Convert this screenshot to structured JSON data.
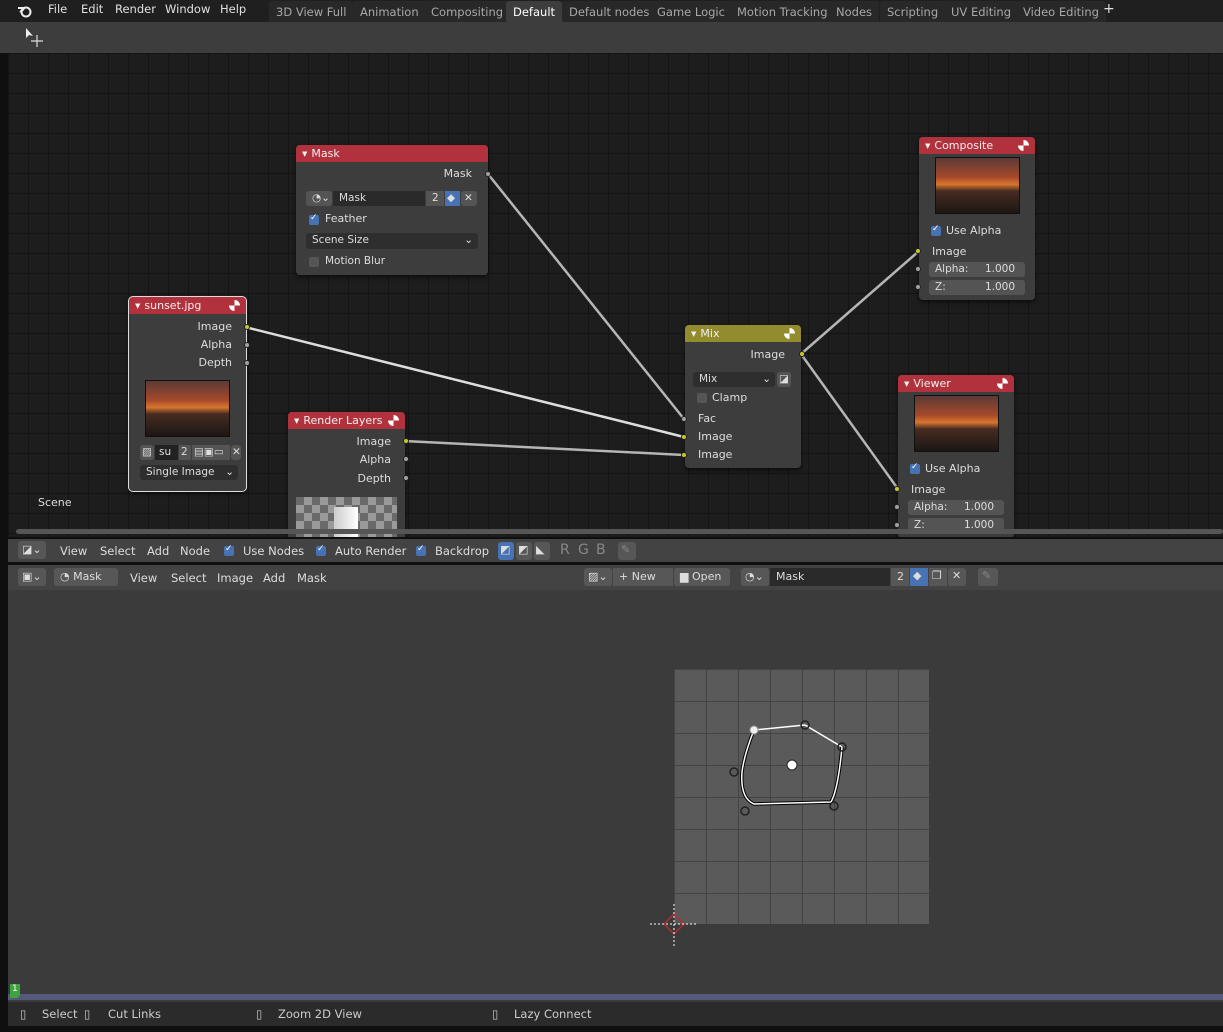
{
  "app": {
    "logo": "blender-logo-icon"
  },
  "menu": [
    "File",
    "Edit",
    "Render",
    "Window",
    "Help"
  ],
  "workspaces": [
    "3D View Full",
    "Animation",
    "Compositing",
    "Default",
    "Default nodes",
    "Game Logic",
    "Motion Tracking",
    "Nodes",
    "Scripting",
    "UV Editing",
    "Video Editing"
  ],
  "active_workspace": "Default",
  "add_workspace": "+",
  "node_editor": {
    "scene_label": "Scene",
    "nodes": {
      "mask": {
        "title": "Mask",
        "output": "Mask",
        "datablock": "Mask",
        "users": "2",
        "feather": "Feather",
        "feather_on": true,
        "size": "Scene Size",
        "motion_blur": "Motion Blur",
        "motion_blur_on": false
      },
      "sunset": {
        "title": "sunset.jpg",
        "outputs": [
          "Image",
          "Alpha",
          "Depth"
        ],
        "image_name": "su",
        "users": "2",
        "source": "Single Image"
      },
      "render_layers": {
        "title": "Render Layers",
        "outputs": [
          "Image",
          "Alpha",
          "Depth"
        ]
      },
      "mix": {
        "title": "Mix",
        "output": "Image",
        "blend": "Mix",
        "clamp": "Clamp",
        "clamp_on": false,
        "inputs": [
          "Fac",
          "Image",
          "Image"
        ]
      },
      "composite": {
        "title": "Composite",
        "use_alpha": "Use Alpha",
        "use_alpha_on": true,
        "input": "Image",
        "alpha_label": "Alpha:",
        "alpha": "1.000",
        "z_label": "Z:",
        "z": "1.000"
      },
      "viewer": {
        "title": "Viewer",
        "use_alpha": "Use Alpha",
        "use_alpha_on": true,
        "input": "Image",
        "alpha_label": "Alpha:",
        "alpha": "1.000",
        "z_label": "Z:",
        "z": "1.000"
      }
    },
    "header": {
      "menus": [
        "View",
        "Select",
        "Add",
        "Node"
      ],
      "use_nodes": "Use Nodes",
      "auto_render": "Auto Render",
      "backdrop": "Backdrop",
      "channels": [
        "R",
        "G",
        "B"
      ]
    },
    "colors": {
      "node_header_red": "#b1323c",
      "node_header_mix": "#928c2e",
      "socket_yellow": "#c7c729",
      "socket_grey": "#a1a1a1"
    }
  },
  "image_editor": {
    "mode": "Mask",
    "menus": [
      "View",
      "Select",
      "Image",
      "Add",
      "Mask"
    ],
    "new": "New",
    "open": "Open",
    "mask_name": "Mask",
    "users": "2"
  },
  "timeline": {
    "current_frame": "1"
  },
  "statusbar": {
    "items": [
      "Select",
      "Cut Links",
      "Zoom 2D View",
      "Lazy Connect"
    ]
  }
}
